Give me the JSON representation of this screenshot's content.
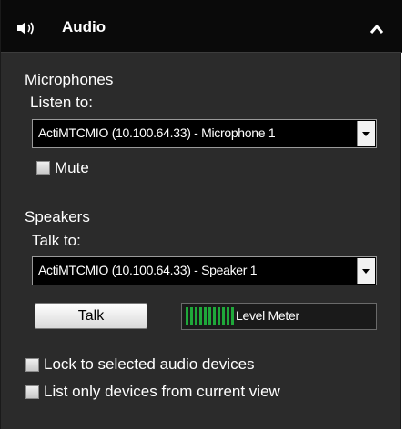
{
  "header": {
    "title": "Audio",
    "icon": "speaker-icon",
    "collapse_icon": "chevron-up-icon"
  },
  "microphones": {
    "section_label": "Microphones",
    "listen_label": "Listen to:",
    "selected_device": "ActiMTCMIO (10.100.64.33) - Microphone 1",
    "mute_label": "Mute",
    "mute_checked": false
  },
  "speakers": {
    "section_label": "Speakers",
    "talk_label": "Talk to:",
    "selected_device": "ActiMTCMIO (10.100.64.33) - Speaker 1",
    "talk_button": "Talk",
    "level_meter_label": "Level Meter",
    "level_meter_color": "#1fa83a"
  },
  "options": {
    "lock_label": "Lock to selected audio devices",
    "lock_checked": false,
    "list_only_label": "List only devices from current view",
    "list_only_checked": false
  },
  "colors": {
    "panel_bg": "#2b2b2b",
    "header_bg": "#0a0a0a"
  }
}
